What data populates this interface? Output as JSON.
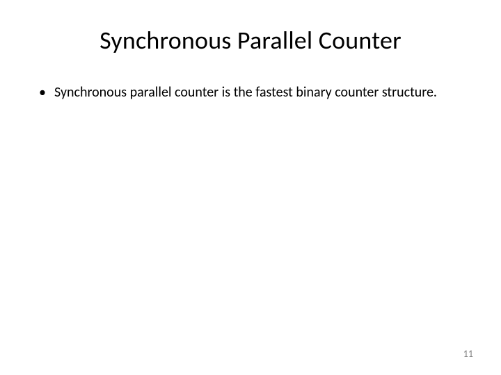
{
  "title": "Synchronous Parallel Counter",
  "bullets": [
    "Synchronous parallel counter is the fastest binary counter structure."
  ],
  "page_number": "11"
}
